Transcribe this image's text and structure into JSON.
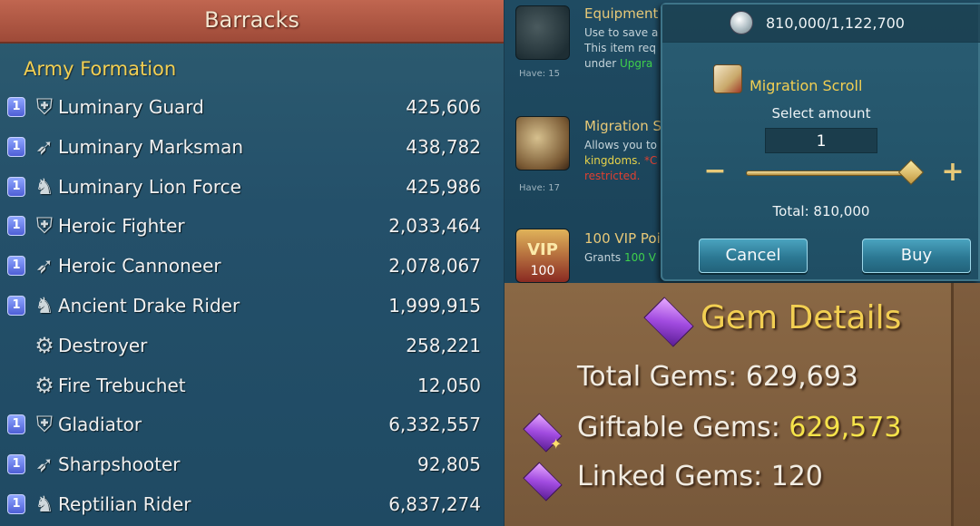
{
  "barracks": {
    "title": "Barracks",
    "section": "Army Formation",
    "troops": [
      {
        "tier": "1",
        "type_icon": "infantry-shield-icon",
        "name": "Luminary Guard",
        "count": "425,606",
        "has_badge": true
      },
      {
        "tier": "1",
        "type_icon": "ranged-bow-icon",
        "name": "Luminary Marksman",
        "count": "438,782",
        "has_badge": true
      },
      {
        "tier": "1",
        "type_icon": "cavalry-horse-icon",
        "name": "Luminary Lion Force",
        "count": "425,986",
        "has_badge": true
      },
      {
        "tier": "1",
        "type_icon": "infantry-shield-icon",
        "name": "Heroic Fighter",
        "count": "2,033,464",
        "has_badge": true
      },
      {
        "tier": "1",
        "type_icon": "ranged-bow-icon",
        "name": "Heroic Cannoneer",
        "count": "2,078,067",
        "has_badge": true
      },
      {
        "tier": "1",
        "type_icon": "cavalry-horse-icon",
        "name": "Ancient Drake Rider",
        "count": "1,999,915",
        "has_badge": true
      },
      {
        "tier": "",
        "type_icon": "siege-icon",
        "name": "Destroyer",
        "count": "258,221",
        "has_badge": false
      },
      {
        "tier": "",
        "type_icon": "siege-icon",
        "name": "Fire Trebuchet",
        "count": "12,050",
        "has_badge": false
      },
      {
        "tier": "1",
        "type_icon": "infantry-shield-icon",
        "name": "Gladiator",
        "count": "6,332,557",
        "has_badge": true
      },
      {
        "tier": "1",
        "type_icon": "ranged-bow-icon",
        "name": "Sharpshooter",
        "count": "92,805",
        "has_badge": true
      },
      {
        "tier": "1",
        "type_icon": "cavalry-horse-icon",
        "name": "Reptilian Rider",
        "count": "6,837,274",
        "has_badge": true
      }
    ]
  },
  "store": {
    "items": [
      {
        "title": "Equipment",
        "desc1": "Use to save a",
        "desc2": "This item req",
        "desc3a": "under ",
        "desc3b": "Upgra",
        "have": "Have: 15"
      },
      {
        "title": "Migration S",
        "desc1": "Allows you to",
        "desc2a": "kingdoms. ",
        "desc2b": "*C",
        "desc3": "restricted.",
        "have": "Have: 17"
      },
      {
        "title": "100 VIP Poi",
        "desc1a": "Grants ",
        "desc1b": "100 V",
        "badge": "100",
        "badge_label": "VIP"
      }
    ]
  },
  "dialog": {
    "balance": "810,000/1,122,700",
    "item_name": "Migration Scroll",
    "select_label": "Select amount",
    "amount": "1",
    "minus": "−",
    "plus": "+",
    "total": "Total: 810,000",
    "cancel": "Cancel",
    "buy": "Buy",
    "slider_fraction": 0.95
  },
  "gems": {
    "title": "Gem Details",
    "total_label": "Total Gems: ",
    "total_value": "629,693",
    "giftable_label": "Giftable Gems: ",
    "giftable_value": "629,573",
    "linked_label": "Linked Gems: ",
    "linked_value": "120"
  },
  "colors": {
    "header_red": "#9e4a38",
    "gold_text": "#f2cf52",
    "panel_teal": "#24506a",
    "gem_brown": "#8a6845"
  }
}
